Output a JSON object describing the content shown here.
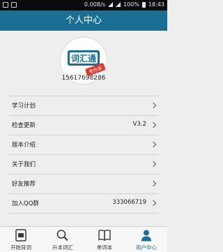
{
  "status_bar": {
    "speed": "0.00B/s",
    "battery": "100%",
    "time": "18:43"
  },
  "title": "个人中心",
  "profile": {
    "phone": "15617698286",
    "logo_text": "词汇通",
    "logo_badge": "专升本"
  },
  "menu": [
    {
      "label": "学习计划",
      "value": "",
      "icon": "chevron-right-icon"
    },
    {
      "label": "检查更新",
      "value": "V3.2",
      "icon": "chevron-right-icon"
    },
    {
      "label": "版本介绍",
      "value": "",
      "icon": "chevron-right-icon"
    },
    {
      "label": "关于我们",
      "value": "",
      "icon": "chevron-right-icon"
    },
    {
      "label": "好友推荐",
      "value": "",
      "icon": "chevron-right-icon"
    },
    {
      "label": "加入QQ群",
      "value": "333066719",
      "icon": "chevron-right-icon"
    }
  ],
  "tabs": [
    {
      "label": "开始背词",
      "icon": "flashcard-icon"
    },
    {
      "label": "升本词汇",
      "icon": "magnifier-icon"
    },
    {
      "label": "单词本",
      "icon": "book-icon"
    },
    {
      "label": "用户中心",
      "icon": "user-icon",
      "active": true
    }
  ],
  "colors": {
    "accent": "#1a6f96",
    "logo_red": "#e03a30",
    "background": "#eeeeee"
  }
}
